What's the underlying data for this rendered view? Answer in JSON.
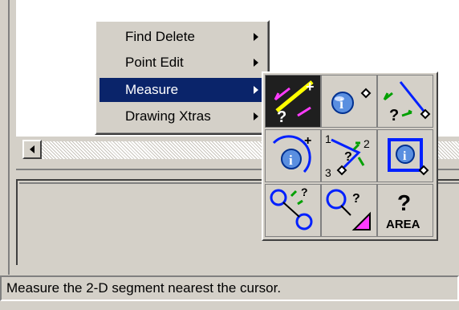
{
  "menu": {
    "items": [
      {
        "label": "Find Delete",
        "has_submenu": true,
        "selected": false
      },
      {
        "label": "Point Edit",
        "has_submenu": true,
        "selected": false
      },
      {
        "label": "Measure",
        "has_submenu": true,
        "selected": true
      },
      {
        "label": "Drawing Xtras",
        "has_submenu": true,
        "selected": false
      }
    ]
  },
  "palette": {
    "tools": [
      {
        "name": "measure-segment-nearest-cursor",
        "icon": "segment-measure-icon",
        "active": true
      },
      {
        "name": "query-point-info",
        "icon": "info-point-icon",
        "active": false
      },
      {
        "name": "measure-segment-distance",
        "icon": "segment-distance-icon",
        "active": false
      },
      {
        "name": "query-arc-info",
        "icon": "arc-info-icon",
        "active": false
      },
      {
        "name": "measure-angle-three-points",
        "icon": "angle-measure-icon",
        "active": false,
        "labels": [
          "1",
          "2",
          "3"
        ]
      },
      {
        "name": "query-object-info",
        "icon": "object-info-icon",
        "active": false
      },
      {
        "name": "measure-circle-distance",
        "icon": "circle-distance-icon",
        "active": false
      },
      {
        "name": "query-circle-area",
        "icon": "circle-query-icon",
        "active": false
      },
      {
        "name": "measure-area",
        "icon": "area-icon",
        "active": false,
        "label": "AREA"
      }
    ]
  },
  "status_bar": {
    "text": "Measure the 2-D segment nearest the cursor."
  },
  "colors": {
    "highlight": "#0a246a",
    "magenta": "#ff3cff",
    "blue": "#0020ff",
    "green": "#00a000",
    "yellow": "#ffff00"
  }
}
